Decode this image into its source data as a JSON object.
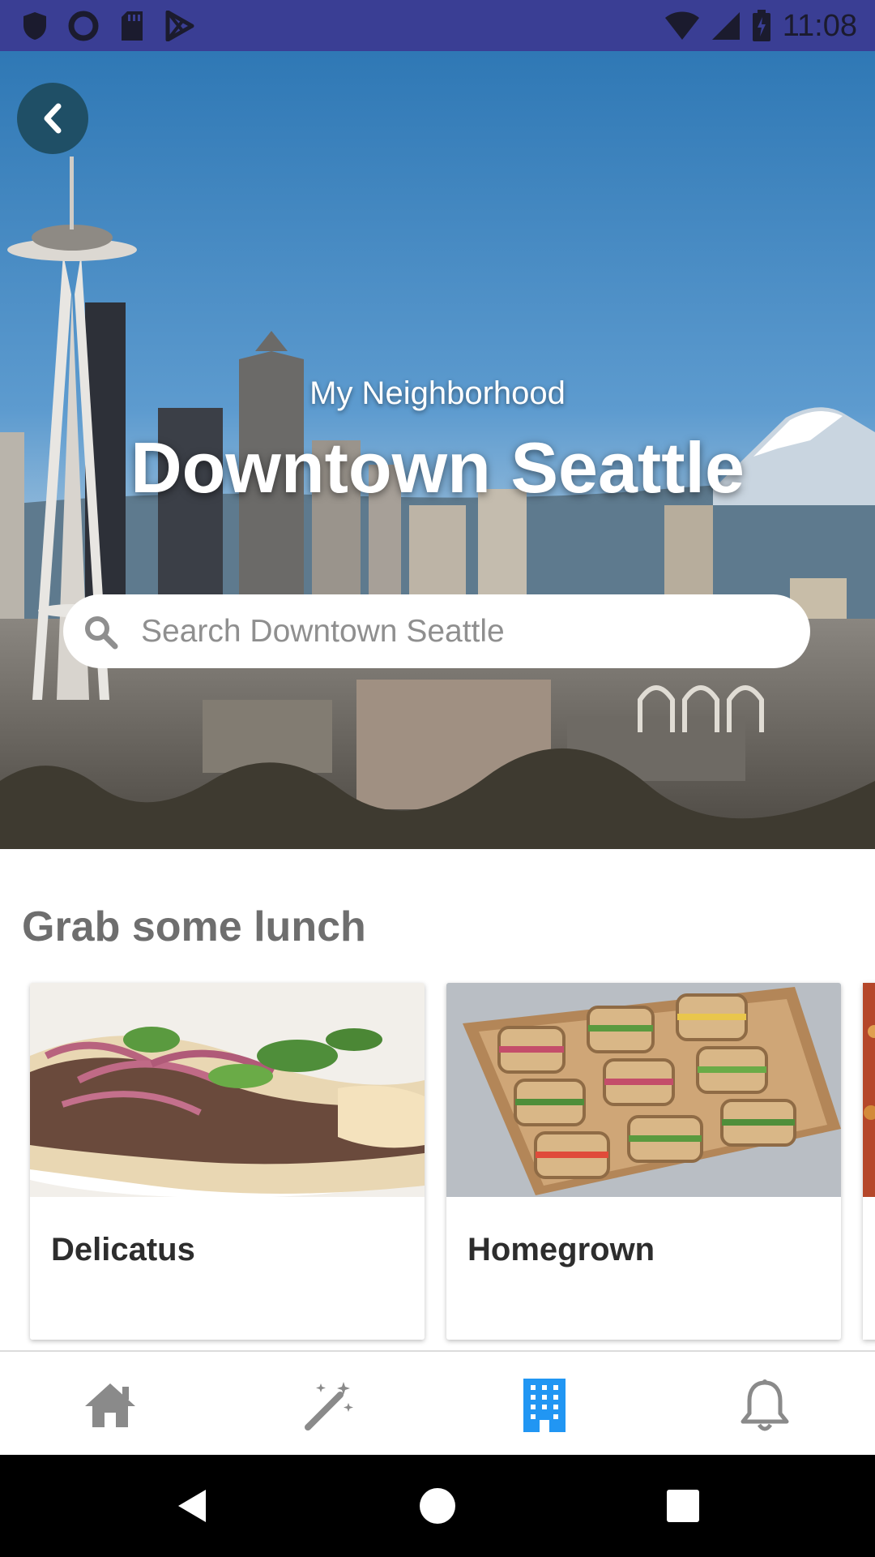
{
  "status_bar": {
    "time": "11:08",
    "left_icons": [
      "shield-icon",
      "circle-icon",
      "sd-card-icon",
      "play-store-icon"
    ],
    "right_icons": [
      "wifi-icon",
      "signal-icon",
      "battery-icon"
    ]
  },
  "hero": {
    "subtitle": "My Neighborhood",
    "title": "Downtown Seattle",
    "search": {
      "placeholder": "Search Downtown Seattle"
    }
  },
  "lunch": {
    "title": "Grab some lunch",
    "cards": [
      {
        "name": "Delicatus"
      },
      {
        "name": "Homegrown"
      }
    ]
  },
  "bottom_nav": {
    "items": [
      {
        "icon": "home-icon",
        "active": false
      },
      {
        "icon": "magic-wand-icon",
        "active": false
      },
      {
        "icon": "building-icon",
        "active": true
      },
      {
        "icon": "bell-icon",
        "active": false
      }
    ],
    "active_color": "#2196f3",
    "inactive_color": "#8a8a8a"
  },
  "colors": {
    "status_bar": "#3a3e94",
    "back_button": "#1f4f66",
    "section_title": "#6e6e6e"
  }
}
